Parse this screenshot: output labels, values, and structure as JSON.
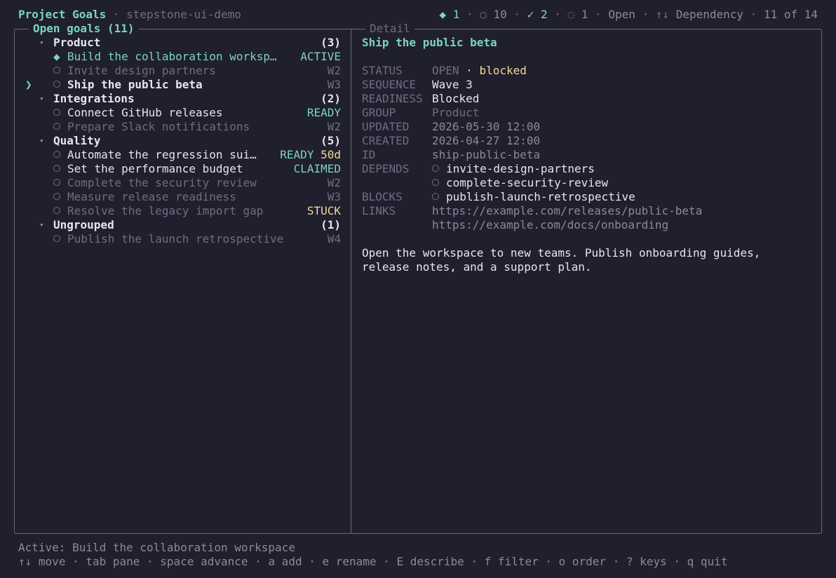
{
  "topbar": {
    "app_title": "Project Goals",
    "sep": " · ",
    "project": "stepstone-ui-demo",
    "counts": {
      "active_icon": "◆",
      "active": "1",
      "open_icon": "○",
      "open": "10",
      "done_icon": "✓",
      "done": "2",
      "blocked_icon": "◌",
      "blocked": "1",
      "view": "Open",
      "order_icon": "↑↓",
      "order": "Dependency",
      "position": "11 of 14"
    }
  },
  "left_pane": {
    "title": "Open goals (11)",
    "cursor_glyph": "❯",
    "caret_glyph": "▾",
    "groups": [
      {
        "name": "Product",
        "count": "(3)",
        "items": [
          {
            "icon": "diamond",
            "title": "Build the collaboration worksp…",
            "status": "ACTIVE",
            "style": "active"
          },
          {
            "icon": "circle",
            "title": "Invite design partners",
            "status": "W2",
            "style": "dim"
          },
          {
            "icon": "circle",
            "title": "Ship the public beta",
            "status": "W3",
            "style": "selected"
          }
        ]
      },
      {
        "name": "Integrations",
        "count": "(2)",
        "items": [
          {
            "icon": "circle",
            "title": "Connect GitHub releases",
            "status": "READY",
            "style": "ready"
          },
          {
            "icon": "circle",
            "title": "Prepare Slack notifications",
            "status": "W2",
            "style": "dim"
          }
        ]
      },
      {
        "name": "Quality",
        "count": "(5)",
        "items": [
          {
            "icon": "circle",
            "title": "Automate the regression sui…",
            "status": "READY",
            "extra": "50d",
            "style": "ready"
          },
          {
            "icon": "circle",
            "title": "Set the performance budget",
            "status": "CLAIMED",
            "style": "claimed"
          },
          {
            "icon": "circle",
            "title": "Complete the security review",
            "status": "W2",
            "style": "dim"
          },
          {
            "icon": "circle",
            "title": "Measure release readiness",
            "status": "W3",
            "style": "dim"
          },
          {
            "icon": "circle",
            "title": "Resolve the legacy import gap",
            "status": "STUCK",
            "style": "stuck"
          }
        ]
      },
      {
        "name": "Ungrouped",
        "count": "(1)",
        "items": [
          {
            "icon": "circle",
            "title": "Publish the launch retrospective",
            "status": "W4",
            "style": "dim"
          }
        ]
      }
    ]
  },
  "detail": {
    "pane_title": "Detail",
    "heading": "Ship the public beta",
    "status_label": "STATUS",
    "status_value": "OPEN",
    "status_dot": "·",
    "status_flag": "blocked",
    "sequence_label": "SEQUENCE",
    "sequence_value": "Wave 3",
    "readiness_label": "READINESS",
    "readiness_value": "Blocked",
    "group_label": "GROUP",
    "group_value": "Product",
    "updated_label": "UPDATED",
    "updated_value": "2026-05-30 12:00",
    "created_label": "CREATED",
    "created_value": "2026-04-27 12:00",
    "id_label": "ID",
    "id_value": "ship-public-beta",
    "depends_label": "DEPENDS",
    "depends": [
      "invite-design-partners",
      "complete-security-review"
    ],
    "blocks_label": "BLOCKS",
    "blocks": [
      "publish-launch-retrospective"
    ],
    "links_label": "LINKS",
    "links": [
      "https://example.com/releases/public-beta",
      "https://example.com/docs/onboarding"
    ],
    "description_lines": [
      "Open the workspace to new teams. Publish onboarding guides,",
      "release notes, and a support plan."
    ]
  },
  "footer": {
    "active_line": "Active: Build the collaboration workspace",
    "keys_line": "↑↓ move · tab pane · space advance · a add · e rename · E describe · f filter · o order · ? keys · q quit"
  }
}
